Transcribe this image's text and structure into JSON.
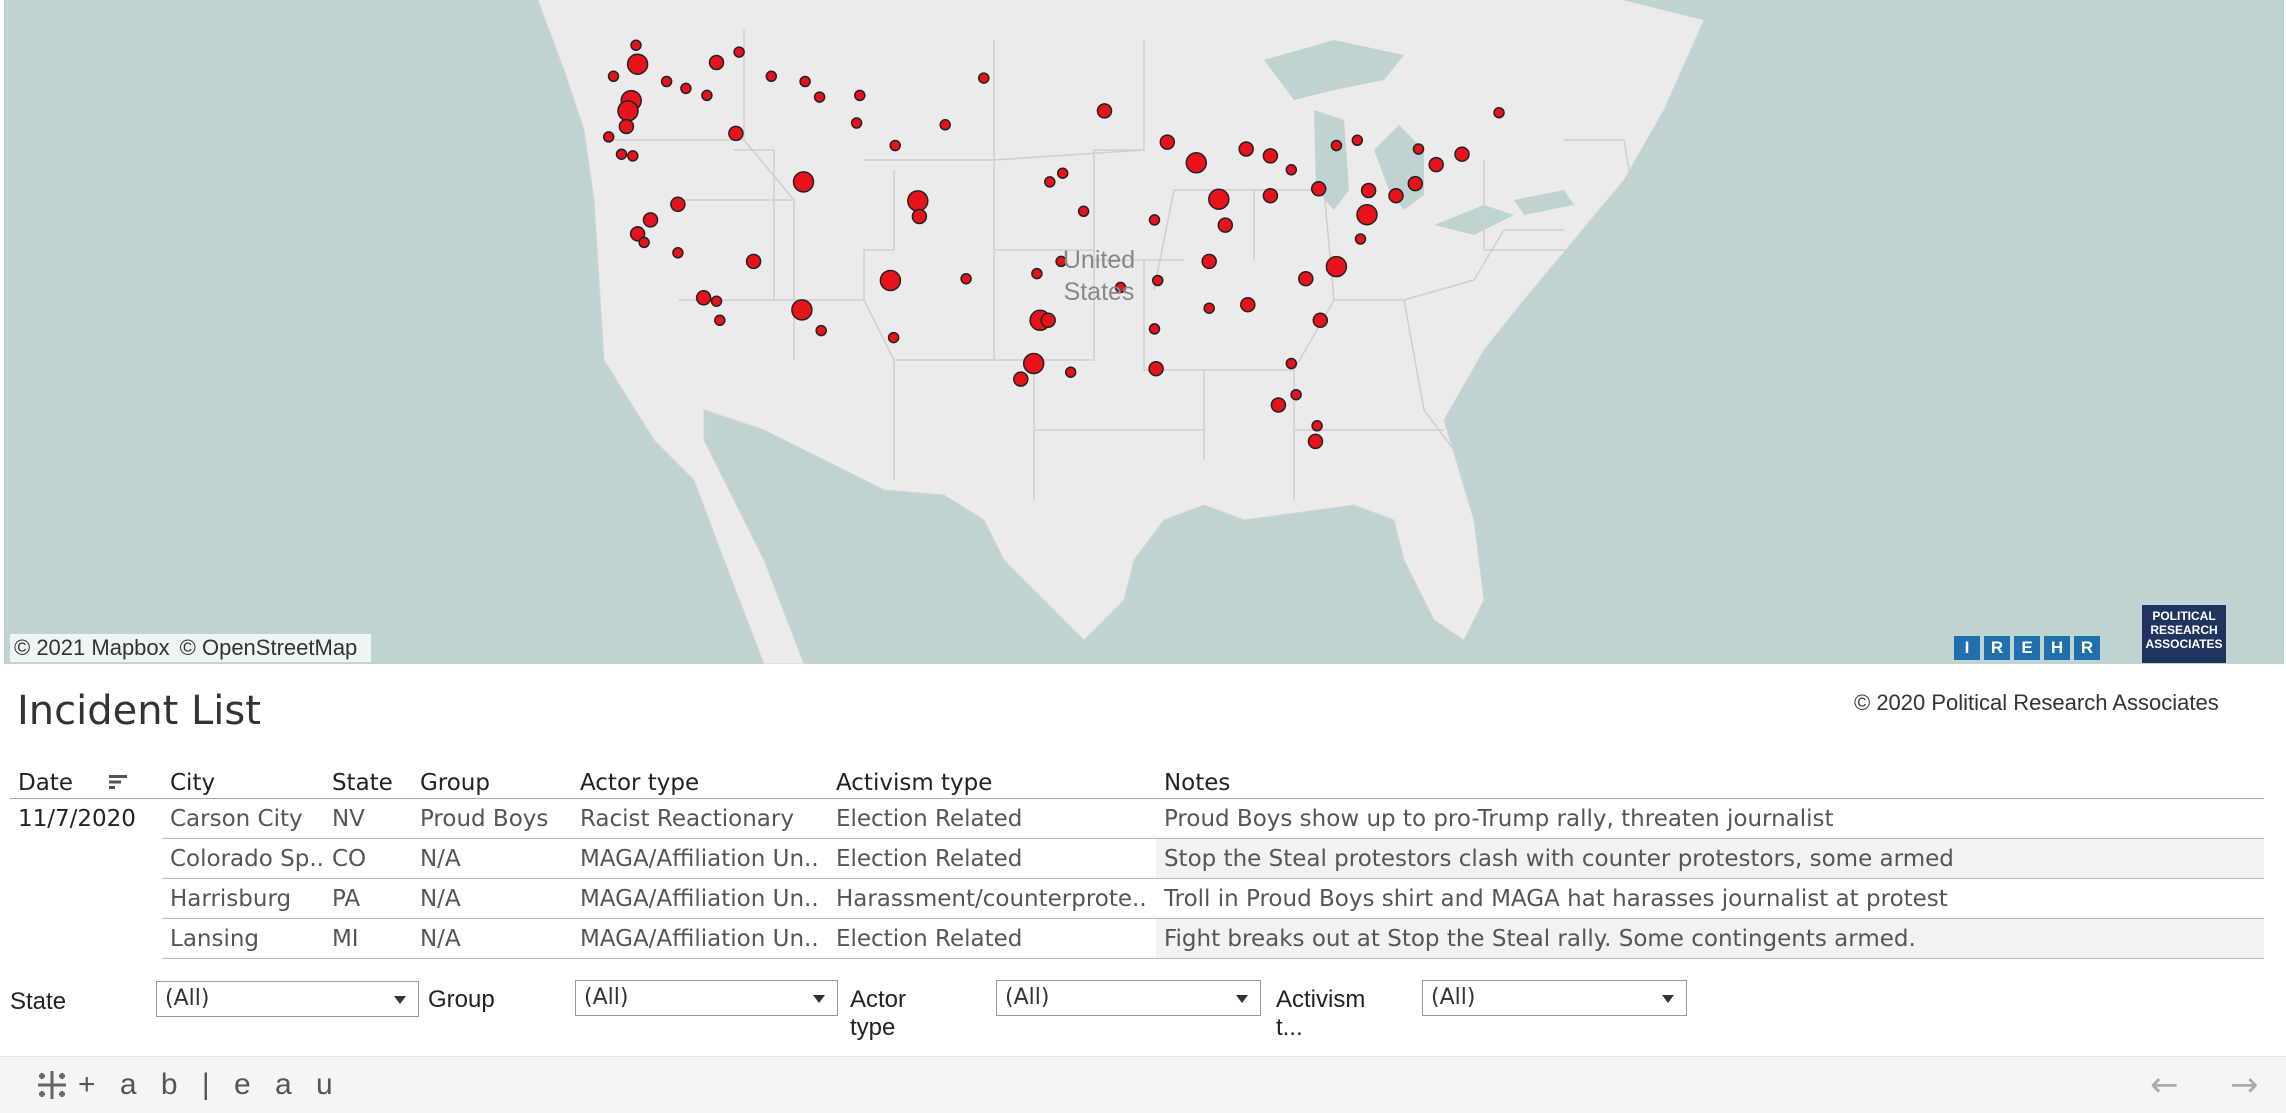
{
  "map": {
    "country_label": [
      "United",
      "States"
    ],
    "attribution": [
      "© 2021 Mapbox",
      "© OpenStreetMap"
    ],
    "irehr_logo": [
      "I",
      "R",
      "E",
      "H",
      "R"
    ],
    "pra_logo": [
      "POLITICAL",
      "RESEARCH",
      "ASSOCIATES"
    ],
    "marker_color": "#e8121b",
    "land_color": "#ebebeb",
    "water_color": "#bfd3d2",
    "incident_points": [
      {
        "lon": -122.3,
        "lat": 47.6,
        "size": "l"
      },
      {
        "lon": -122.7,
        "lat": 45.5,
        "size": "l"
      },
      {
        "lon": -122.9,
        "lat": 44.9,
        "size": "l"
      },
      {
        "lon": -123.0,
        "lat": 44.0,
        "size": "m"
      },
      {
        "lon": -122.4,
        "lat": 48.7,
        "size": "s"
      },
      {
        "lon": -123.8,
        "lat": 46.9,
        "size": "s"
      },
      {
        "lon": -124.1,
        "lat": 43.4,
        "size": "s"
      },
      {
        "lon": -123.3,
        "lat": 42.4,
        "size": "s"
      },
      {
        "lon": -122.6,
        "lat": 42.3,
        "size": "s"
      },
      {
        "lon": -117.4,
        "lat": 47.7,
        "size": "m"
      },
      {
        "lon": -116.2,
        "lat": 43.6,
        "size": "m"
      },
      {
        "lon": -119.3,
        "lat": 46.2,
        "size": "s"
      },
      {
        "lon": -118.0,
        "lat": 45.8,
        "size": "s"
      },
      {
        "lon": -120.5,
        "lat": 46.6,
        "size": "s"
      },
      {
        "lon": -114.0,
        "lat": 46.9,
        "size": "s"
      },
      {
        "lon": -111.0,
        "lat": 45.7,
        "size": "s"
      },
      {
        "lon": -108.5,
        "lat": 45.8,
        "size": "s"
      },
      {
        "lon": -112.0,
        "lat": 40.8,
        "size": "l"
      },
      {
        "lon": -121.5,
        "lat": 38.6,
        "size": "m"
      },
      {
        "lon": -122.3,
        "lat": 37.8,
        "size": "m"
      },
      {
        "lon": -121.9,
        "lat": 37.3,
        "size": "s"
      },
      {
        "lon": -119.8,
        "lat": 39.5,
        "size": "m"
      },
      {
        "lon": -119.8,
        "lat": 36.7,
        "size": "s"
      },
      {
        "lon": -118.2,
        "lat": 34.1,
        "size": "m"
      },
      {
        "lon": -117.4,
        "lat": 33.9,
        "size": "s"
      },
      {
        "lon": -117.2,
        "lat": 32.8,
        "size": "s"
      },
      {
        "lon": -115.1,
        "lat": 36.2,
        "size": "m"
      },
      {
        "lon": -112.1,
        "lat": 33.4,
        "size": "l"
      },
      {
        "lon": -110.9,
        "lat": 32.2,
        "size": "s"
      },
      {
        "lon": -106.6,
        "lat": 35.1,
        "size": "l"
      },
      {
        "lon": -104.9,
        "lat": 39.7,
        "size": "l"
      },
      {
        "lon": -104.8,
        "lat": 38.8,
        "size": "m"
      },
      {
        "lon": -106.4,
        "lat": 31.8,
        "size": "s"
      },
      {
        "lon": -101.9,
        "lat": 35.2,
        "size": "s"
      },
      {
        "lon": -97.3,
        "lat": 32.8,
        "size": "l"
      },
      {
        "lon": -96.8,
        "lat": 32.8,
        "size": "m"
      },
      {
        "lon": -97.7,
        "lat": 30.3,
        "size": "l"
      },
      {
        "lon": -98.5,
        "lat": 29.4,
        "size": "m"
      },
      {
        "lon": -95.4,
        "lat": 29.8,
        "size": "s"
      },
      {
        "lon": -97.5,
        "lat": 35.5,
        "size": "s"
      },
      {
        "lon": -96.0,
        "lat": 36.2,
        "size": "s"
      },
      {
        "lon": -94.6,
        "lat": 39.1,
        "size": "s"
      },
      {
        "lon": -93.3,
        "lat": 44.9,
        "size": "m"
      },
      {
        "lon": -96.7,
        "lat": 40.8,
        "size": "s"
      },
      {
        "lon": -89.4,
        "lat": 43.1,
        "size": "m"
      },
      {
        "lon": -87.6,
        "lat": 41.9,
        "size": "l"
      },
      {
        "lon": -86.2,
        "lat": 39.8,
        "size": "l"
      },
      {
        "lon": -84.5,
        "lat": 42.7,
        "size": "m"
      },
      {
        "lon": -83.0,
        "lat": 42.3,
        "size": "m"
      },
      {
        "lon": -83.0,
        "lat": 40.0,
        "size": "m"
      },
      {
        "lon": -81.7,
        "lat": 41.5,
        "size": "s"
      },
      {
        "lon": -80.0,
        "lat": 40.4,
        "size": "m"
      },
      {
        "lon": -76.9,
        "lat": 40.3,
        "size": "m"
      },
      {
        "lon": -77.0,
        "lat": 38.9,
        "size": "l"
      },
      {
        "lon": -75.2,
        "lat": 40.0,
        "size": "m"
      },
      {
        "lon": -74.0,
        "lat": 40.7,
        "size": "m"
      },
      {
        "lon": -71.1,
        "lat": 42.4,
        "size": "m"
      },
      {
        "lon": -73.8,
        "lat": 42.7,
        "size": "s"
      },
      {
        "lon": -78.9,
        "lat": 35.9,
        "size": "l"
      },
      {
        "lon": -80.8,
        "lat": 35.2,
        "size": "m"
      },
      {
        "lon": -77.4,
        "lat": 37.5,
        "size": "s"
      },
      {
        "lon": -84.4,
        "lat": 33.7,
        "size": "m"
      },
      {
        "lon": -86.8,
        "lat": 33.5,
        "size": "s"
      },
      {
        "lon": -90.2,
        "lat": 32.3,
        "size": "s"
      },
      {
        "lon": -90.1,
        "lat": 30.0,
        "size": "m"
      },
      {
        "lon": -86.8,
        "lat": 36.2,
        "size": "m"
      },
      {
        "lon": -85.8,
        "lat": 38.3,
        "size": "m"
      },
      {
        "lon": -82.5,
        "lat": 27.9,
        "size": "m"
      },
      {
        "lon": -81.4,
        "lat": 28.5,
        "size": "s"
      },
      {
        "lon": -80.2,
        "lat": 25.8,
        "size": "m"
      },
      {
        "lon": -80.1,
        "lat": 26.7,
        "size": "s"
      },
      {
        "lon": -81.7,
        "lat": 30.3,
        "size": "s"
      },
      {
        "lon": -79.9,
        "lat": 32.8,
        "size": "m"
      },
      {
        "lon": -90.0,
        "lat": 35.1,
        "size": "s"
      },
      {
        "lon": -92.3,
        "lat": 34.7,
        "size": "s"
      },
      {
        "lon": -90.2,
        "lat": 38.6,
        "size": "s"
      },
      {
        "lon": -95.9,
        "lat": 41.3,
        "size": "s"
      },
      {
        "lon": -100.8,
        "lat": 46.8,
        "size": "s"
      },
      {
        "lon": -103.2,
        "lat": 44.1,
        "size": "s"
      },
      {
        "lon": -108.7,
        "lat": 44.2,
        "size": "s"
      },
      {
        "lon": -106.3,
        "lat": 42.9,
        "size": "s"
      },
      {
        "lon": -111.9,
        "lat": 46.6,
        "size": "s"
      },
      {
        "lon": -116.0,
        "lat": 48.3,
        "size": "s"
      },
      {
        "lon": -68.8,
        "lat": 44.8,
        "size": "s"
      },
      {
        "lon": -72.7,
        "lat": 41.8,
        "size": "m"
      },
      {
        "lon": -77.6,
        "lat": 43.2,
        "size": "s"
      },
      {
        "lon": -78.9,
        "lat": 42.9,
        "size": "s"
      }
    ]
  },
  "incident_list": {
    "title": "Incident List",
    "copyright": "© 2020 Political Research Associates",
    "columns": [
      "Date",
      "City",
      "State",
      "Group",
      "Actor type",
      "Activism type",
      "Notes"
    ],
    "date": "11/7/2020",
    "rows": [
      {
        "city": "Carson City",
        "state": "NV",
        "group": "Proud Boys",
        "actor_type": "Racist Reactionary",
        "activism_type": "Election Related",
        "notes": "Proud Boys show up to pro-Trump rally, threaten journalist"
      },
      {
        "city": "Colorado Sp..",
        "state": "CO",
        "group": "N/A",
        "actor_type": "MAGA/Affiliation Un..",
        "activism_type": "Election Related",
        "notes": "Stop the Steal protestors clash with counter protestors, some armed"
      },
      {
        "city": "Harrisburg",
        "state": "PA",
        "group": "N/A",
        "actor_type": "MAGA/Affiliation Un..",
        "activism_type": "Harassment/counterprote..",
        "notes": "Troll in Proud Boys shirt and MAGA hat harasses journalist at protest"
      },
      {
        "city": "Lansing",
        "state": "MI",
        "group": "N/A",
        "actor_type": "MAGA/Affiliation Un..",
        "activism_type": "Election Related",
        "notes": "Fight breaks out at Stop the Steal rally. Some contingents armed."
      }
    ]
  },
  "filters": {
    "state": {
      "label": "State",
      "value": "(All)"
    },
    "group": {
      "label": "Group",
      "value": "(All)"
    },
    "actor_type": {
      "label": "Actor type",
      "value": "(All)"
    },
    "activism_type": {
      "label": "Activism t...",
      "value": "(All)"
    }
  },
  "footer": {
    "brand": "+ a b | e a u",
    "prev_icon": "arrow-left-icon",
    "next_icon": "arrow-right-icon"
  }
}
